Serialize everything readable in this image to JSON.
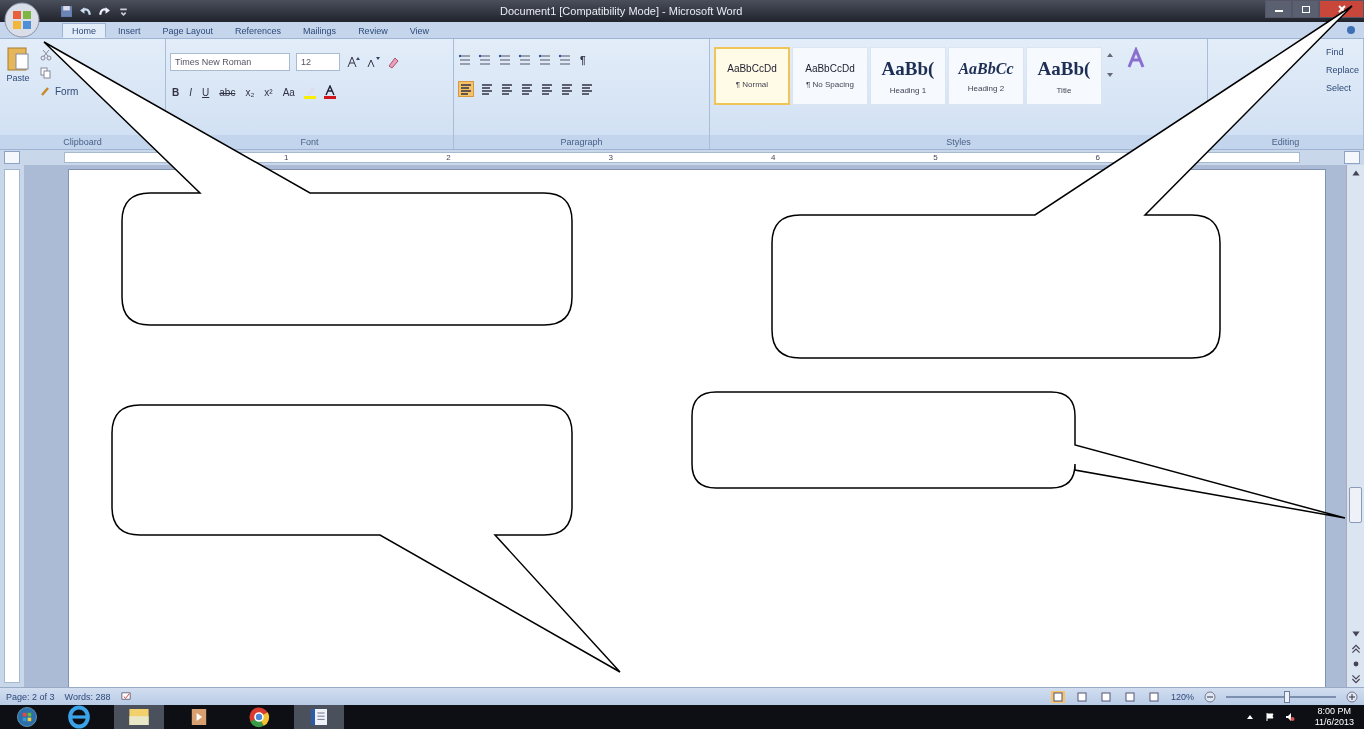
{
  "title_bar": {
    "title": "Document1 [Compatibility Mode] - Microsoft Word"
  },
  "tabs": [
    {
      "label": "Home",
      "selected": true
    },
    {
      "label": "Insert",
      "selected": false
    },
    {
      "label": "Page Layout",
      "selected": false
    },
    {
      "label": "References",
      "selected": false
    },
    {
      "label": "Mailings",
      "selected": false
    },
    {
      "label": "Review",
      "selected": false
    },
    {
      "label": "View",
      "selected": false
    }
  ],
  "ribbon": {
    "clipboard": {
      "paste": "Paste",
      "format_painter": "Form",
      "label": "Clipboard"
    },
    "font": {
      "name": "Times New Roman",
      "size": "12",
      "buttons": [
        "B",
        "I",
        "U",
        "abc",
        "x₂",
        "x²",
        "Aa"
      ],
      "label": "Font"
    },
    "paragraph": {
      "show_marks": "¶",
      "label": "Paragraph"
    },
    "styles": {
      "items": [
        {
          "preview": "AaBbCcDd",
          "name": "¶ Normal",
          "kind": "body",
          "selected": true
        },
        {
          "preview": "AaBbCcDd",
          "name": "¶ No Spacing",
          "kind": "body",
          "selected": false
        },
        {
          "preview": "AaBb(",
          "name": "Heading 1",
          "kind": "heading",
          "selected": false
        },
        {
          "preview": "AaBbCc",
          "name": "Heading 2",
          "kind": "italic",
          "selected": false
        },
        {
          "preview": "AaBb(",
          "name": "Title",
          "kind": "heading",
          "selected": false
        }
      ],
      "label": "Styles"
    },
    "editing": {
      "items": [
        "Find",
        "Replace",
        "Select"
      ],
      "label": "Editing"
    }
  },
  "ruler": {
    "numbers": [
      "1",
      "2",
      "3",
      "4",
      "5",
      "6"
    ]
  },
  "status_bar": {
    "page": "Page: 2 of 3",
    "words": "Words: 288",
    "zoom": "120%",
    "zoom_slider": {
      "level": 0.55
    }
  },
  "taskbar": {
    "time": "8:00 PM",
    "date": "11/6/2013"
  }
}
